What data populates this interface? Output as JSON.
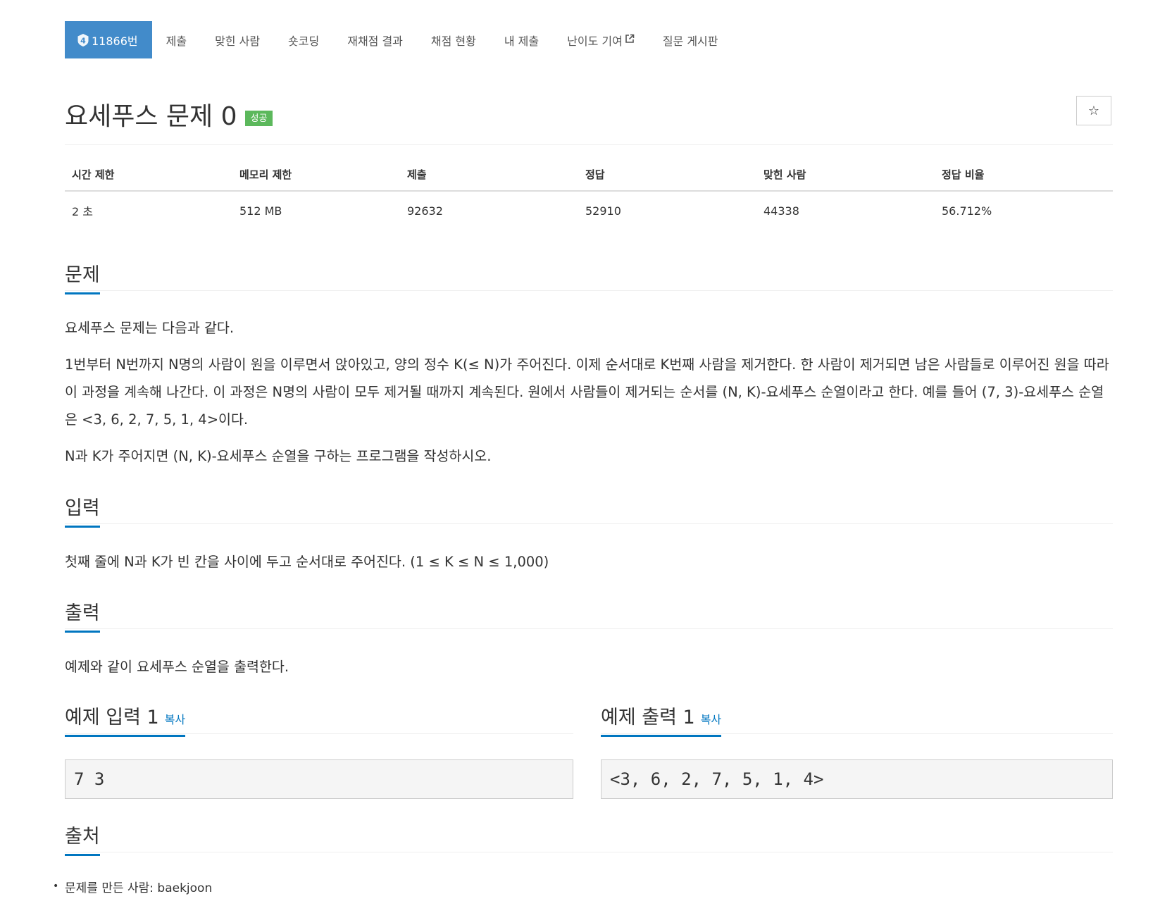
{
  "nav": {
    "problem_number": "11866번",
    "tier_level": "4",
    "tabs": [
      "제출",
      "맞힌 사람",
      "숏코딩",
      "재채점 결과",
      "채점 현황",
      "내 제출",
      "난이도 기여",
      "질문 게시판"
    ]
  },
  "title": "요세푸스 문제 0",
  "status_badge": "성공",
  "star_icon": "☆",
  "stats": {
    "headers": [
      "시간 제한",
      "메모리 제한",
      "제출",
      "정답",
      "맞힌 사람",
      "정답 비율"
    ],
    "values": [
      "2 초",
      "512 MB",
      "92632",
      "52910",
      "44338",
      "56.712%"
    ]
  },
  "sections": {
    "problem": {
      "heading": "문제",
      "paragraphs": [
        "요세푸스 문제는 다음과 같다.",
        "1번부터 N번까지 N명의 사람이 원을 이루면서 앉아있고, 양의 정수 K(≤ N)가 주어진다. 이제 순서대로 K번째 사람을 제거한다. 한 사람이 제거되면 남은 사람들로 이루어진 원을 따라 이 과정을 계속해 나간다. 이 과정은 N명의 사람이 모두 제거될 때까지 계속된다. 원에서 사람들이 제거되는 순서를 (N, K)-요세푸스 순열이라고 한다. 예를 들어 (7, 3)-요세푸스 순열은 <3, 6, 2, 7, 5, 1, 4>이다.",
        "N과 K가 주어지면 (N, K)-요세푸스 순열을 구하는 프로그램을 작성하시오."
      ]
    },
    "input": {
      "heading": "입력",
      "text": "첫째 줄에 N과 K가 빈 칸을 사이에 두고 순서대로 주어진다. (1 ≤ K ≤ N ≤ 1,000)"
    },
    "output": {
      "heading": "출력",
      "text": "예제와 같이 요세푸스 순열을 출력한다."
    },
    "sample_input": {
      "heading": "예제 입력 1",
      "copy": "복사",
      "content": "7 3"
    },
    "sample_output": {
      "heading": "예제 출력 1",
      "copy": "복사",
      "content": "<3, 6, 2, 7, 5, 1, 4>"
    },
    "source": {
      "heading": "출처",
      "items": [
        "문제를 만든 사람: baekjoon"
      ]
    }
  },
  "colors": {
    "primary": "#428bca",
    "success": "#5cb85c",
    "link": "#0076c0"
  }
}
